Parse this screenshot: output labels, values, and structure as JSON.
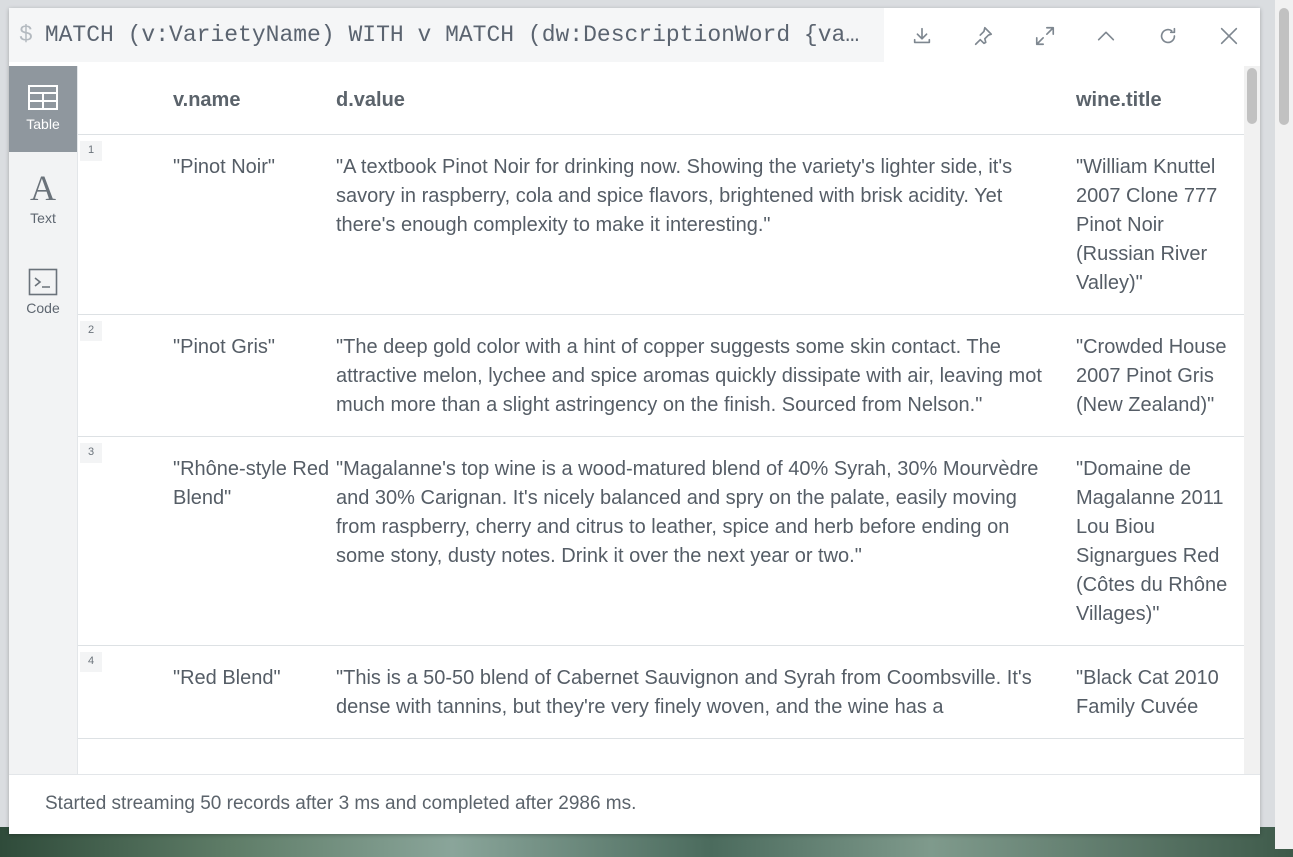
{
  "header": {
    "prompt_symbol": "$",
    "query": "MATCH (v:VarietyName) WITH v MATCH (dw:DescriptionWord {va…",
    "buttons": [
      "download-icon",
      "pin-icon",
      "expand-icon",
      "collapse-icon",
      "rerun-icon",
      "close-icon"
    ]
  },
  "sidebar": {
    "items": [
      {
        "label": "Table",
        "icon": "table-icon",
        "active": true
      },
      {
        "label": "Text",
        "icon": "text-icon",
        "active": false
      },
      {
        "label": "Code",
        "icon": "code-icon",
        "active": false
      }
    ]
  },
  "table": {
    "columns": [
      "v.name",
      "d.value",
      "wine.title"
    ],
    "rows": [
      {
        "index": "1",
        "name": "\"Pinot Noir\"",
        "value": "\"A textbook Pinot Noir for drinking now. Showing the variety's lighter side, it's savory in raspberry, cola and spice flavors, brightened with brisk acidity. Yet there's enough complexity to make it interesting.\"",
        "title": "\"William Knuttel 2007 Clone 777 Pinot Noir (Russian River Valley)\""
      },
      {
        "index": "2",
        "name": "\"Pinot Gris\"",
        "value": "\"The deep gold color with a hint of copper suggests some skin contact. The attractive melon, lychee and spice aromas quickly dissipate with air, leaving mot much more than a slight astringency on the finish. Sourced from Nelson.\"",
        "title": "\"Crowded House 2007 Pinot Gris (New Zealand)\""
      },
      {
        "index": "3",
        "name": "\"Rhône-style Red Blend\"",
        "value": "\"Magalanne's top wine is a wood-matured blend of 40% Syrah, 30% Mourvèdre and 30% Carignan. It's nicely balanced and spry on the palate, easily moving from raspberry, cherry and citrus to leather, spice and herb before ending on some stony, dusty notes. Drink it over the next year or two.\"",
        "title": "\"Domaine de Magalanne 2011 Lou Biou Signargues Red (Côtes du Rhône Villages)\""
      },
      {
        "index": "4",
        "name": "\"Red Blend\"",
        "value": "\"This is a 50-50 blend of Cabernet Sauvignon and Syrah from Coombsville. It's dense with tannins, but they're very finely woven, and the wine has a",
        "title": "\"Black Cat 2010 Family Cuvée"
      }
    ]
  },
  "footer": {
    "status": "Started streaming 50 records after 3 ms and completed after 2986 ms."
  }
}
